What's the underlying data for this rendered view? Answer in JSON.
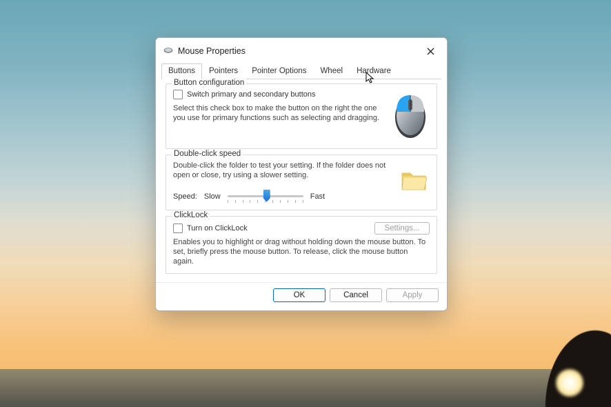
{
  "window": {
    "title": "Mouse Properties"
  },
  "tabs": [
    "Buttons",
    "Pointers",
    "Pointer Options",
    "Wheel",
    "Hardware"
  ],
  "active_tab_index": 0,
  "groups": {
    "button_config": {
      "title": "Button configuration",
      "checkbox_label": "Switch primary and secondary buttons",
      "checkbox_checked": false,
      "description": "Select this check box to make the button on the right the one you use for primary functions such as selecting and dragging."
    },
    "double_click": {
      "title": "Double-click speed",
      "description": "Double-click the folder to test your setting. If the folder does not open or close, try using a slower setting.",
      "speed_label": "Speed:",
      "slow_label": "Slow",
      "fast_label": "Fast",
      "slider_value": 5,
      "slider_min": 0,
      "slider_max": 10
    },
    "clicklock": {
      "title": "ClickLock",
      "checkbox_label": "Turn on ClickLock",
      "checkbox_checked": false,
      "settings_button": "Settings...",
      "description": "Enables you to highlight or drag without holding down the mouse button. To set, briefly press the mouse button. To release, click the mouse button again."
    }
  },
  "footer": {
    "ok": "OK",
    "cancel": "Cancel",
    "apply": "Apply"
  }
}
